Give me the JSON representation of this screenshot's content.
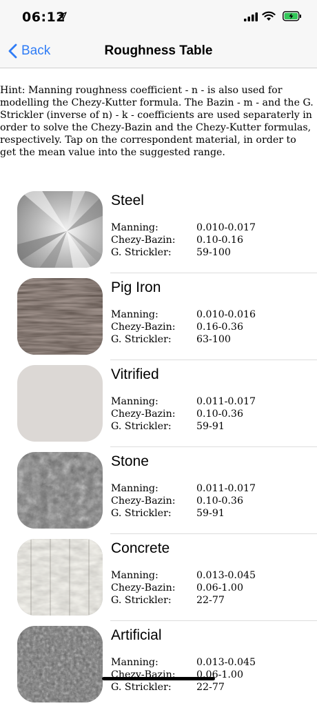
{
  "status": {
    "time": "06:12"
  },
  "nav": {
    "back_label": "Back",
    "title": "Roughness Table"
  },
  "hint": "Hint: Manning roughness coefficient - n - is also used for modelling the Chezy-Kutter formula. The Bazin - m - and the G. Strickler (inverse of n) - k - coefficients are used separaterly in order to solve the Chezy-Bazin and the Chezy-Kutter formulas, respectively. Tap on the correspondent material, in order to get the mean value into the suggested range.",
  "labels": {
    "manning": "Manning:",
    "chezy": "Chezy-Bazin:",
    "strickler": "G. Strickler:"
  },
  "materials": [
    {
      "name": "Steel",
      "manning": "0.010-0.017",
      "chezy": "0.10-0.16",
      "strickler": "59-100"
    },
    {
      "name": "Pig Iron",
      "manning": "0.010-0.016",
      "chezy": "0.16-0.36",
      "strickler": "63-100"
    },
    {
      "name": "Vitrified",
      "manning": "0.011-0.017",
      "chezy": "0.10-0.36",
      "strickler": "59-91"
    },
    {
      "name": "Stone",
      "manning": "0.011-0.017",
      "chezy": "0.10-0.36",
      "strickler": "59-91"
    },
    {
      "name": "Concrete",
      "manning": "0.013-0.045",
      "chezy": "0.06-1.00",
      "strickler": "22-77"
    },
    {
      "name": "Artificial",
      "manning": "0.013-0.045",
      "chezy": "0.06-1.00",
      "strickler": "22-77"
    }
  ]
}
